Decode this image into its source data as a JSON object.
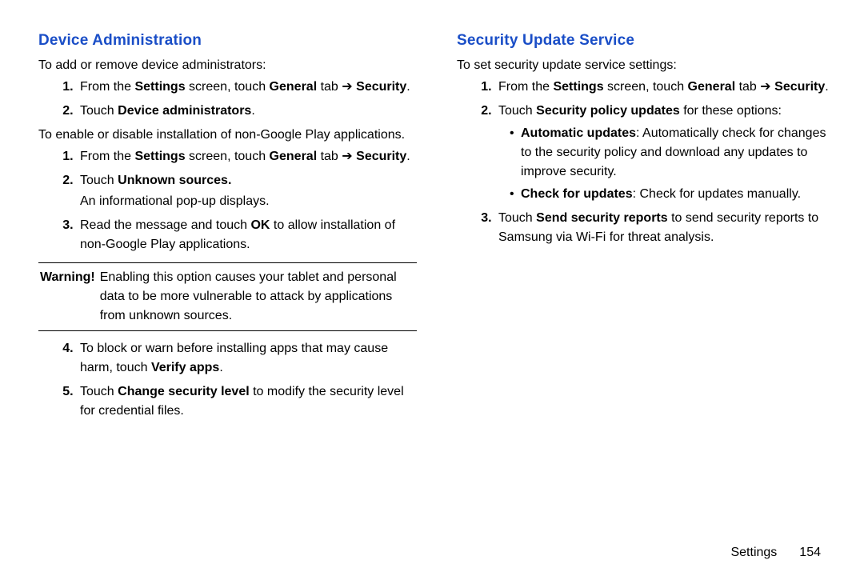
{
  "left": {
    "heading": "Device Administration",
    "intro1": "To add or remove device administrators:",
    "list1": {
      "i1_a": "From the ",
      "i1_b": "Settings",
      "i1_c": " screen, touch ",
      "i1_d": "General",
      "i1_e": " tab ",
      "i1_f": "➔",
      "i1_g": " ",
      "i1_h": "Security",
      "i1_i": ".",
      "i2_a": "Touch ",
      "i2_b": "Device administrators",
      "i2_c": "."
    },
    "intro2": "To enable or disable installation of non-Google Play applications.",
    "list2": {
      "i1_a": "From the ",
      "i1_b": "Settings",
      "i1_c": " screen, touch ",
      "i1_d": "General",
      "i1_e": " tab ",
      "i1_f": "➔",
      "i1_g": " ",
      "i1_h": "Security",
      "i1_i": ".",
      "i2_a": "Touch ",
      "i2_b": "Unknown sources.",
      "i2_follow": "An informational pop-up displays.",
      "i3_a": "Read the message and touch ",
      "i3_b": "OK",
      "i3_c": " to allow installation of non-Google Play applications."
    },
    "warning_label": "Warning!",
    "warning_text": "Enabling this option causes your tablet and personal data to be more vulnerable to attack by applications from unknown sources.",
    "list3": {
      "i4_a": "To block or warn before installing apps that may cause harm, touch ",
      "i4_b": "Verify apps",
      "i4_c": ".",
      "i5_a": "Touch ",
      "i5_b": "Change security level",
      "i5_c": " to modify the security level for credential files."
    }
  },
  "right": {
    "heading": "Security Update Service",
    "intro": "To set security update service settings:",
    "list": {
      "i1_a": "From the ",
      "i1_b": "Settings",
      "i1_c": " screen, touch ",
      "i1_d": "General",
      "i1_e": " tab ",
      "i1_f": "➔",
      "i1_g": " ",
      "i1_h": "Security",
      "i1_i": ".",
      "i2_a": "Touch ",
      "i2_b": "Security policy updates",
      "i2_c": " for these options:",
      "b1_b": "Automatic updates",
      "b1_rest": ": Automatically check for changes to the security policy and download any updates to improve security.",
      "b2_b": "Check for updates",
      "b2_rest": ": Check for updates manually.",
      "i3_a": "Touch ",
      "i3_b": "Send security reports",
      "i3_c": " to send security reports to Samsung via Wi-Fi for threat analysis."
    }
  },
  "footer": {
    "section": "Settings",
    "page": "154"
  }
}
